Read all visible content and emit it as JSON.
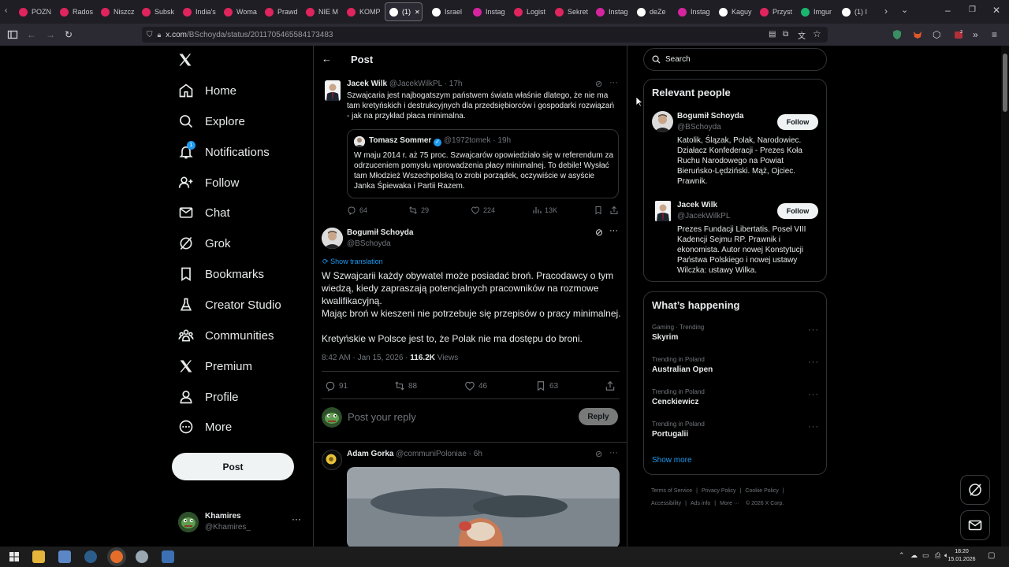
{
  "browser": {
    "tabs": [
      {
        "label": "POZN",
        "fav": "#e0245e"
      },
      {
        "label": "Rados",
        "fav": "#e0245e"
      },
      {
        "label": "Niszcz",
        "fav": "#e0245e"
      },
      {
        "label": "Subsk",
        "fav": "#e0245e"
      },
      {
        "label": "India's",
        "fav": "#e0245e"
      },
      {
        "label": "Woma",
        "fav": "#e0245e"
      },
      {
        "label": "Prawd",
        "fav": "#e0245e"
      },
      {
        "label": "NIE M",
        "fav": "#e0245e"
      },
      {
        "label": "KOMP",
        "fav": "#e0245e"
      },
      {
        "label": "(1)",
        "fav": "#ffffff",
        "active": true
      },
      {
        "label": "Israel",
        "fav": "#ffffff"
      },
      {
        "label": "Instag",
        "fav": "#d6249f"
      },
      {
        "label": "Logist",
        "fav": "#e0245e"
      },
      {
        "label": "Sekret",
        "fav": "#e0245e"
      },
      {
        "label": "Instag",
        "fav": "#d6249f"
      },
      {
        "label": "deZe",
        "fav": "#ffffff"
      },
      {
        "label": "Instag",
        "fav": "#d6249f"
      },
      {
        "label": "Kaguy",
        "fav": "#ffffff"
      },
      {
        "label": "Przyst",
        "fav": "#e0245e"
      },
      {
        "label": "Imgur",
        "fav": "#1bb76e"
      },
      {
        "label": "(1) I",
        "fav": "#ffffff"
      }
    ],
    "url_host": "x.com",
    "url_path": "/BSchoyda/status/2011705465584173483"
  },
  "nav": {
    "items": [
      {
        "label": "Home",
        "icon": "home-icon"
      },
      {
        "label": "Explore",
        "icon": "search-icon"
      },
      {
        "label": "Notifications",
        "icon": "bell-icon",
        "badge": "1"
      },
      {
        "label": "Follow",
        "icon": "add-user-icon"
      },
      {
        "label": "Chat",
        "icon": "mail-icon"
      },
      {
        "label": "Grok",
        "icon": "grok-icon"
      },
      {
        "label": "Bookmarks",
        "icon": "bookmark-icon"
      },
      {
        "label": "Creator Studio",
        "icon": "flask-icon"
      },
      {
        "label": "Communities",
        "icon": "communities-icon"
      },
      {
        "label": "Premium",
        "icon": "x-logo-icon"
      },
      {
        "label": "Profile",
        "icon": "person-icon"
      },
      {
        "label": "More",
        "icon": "more-circle-icon"
      }
    ],
    "post_label": "Post",
    "account": {
      "name": "Khamires",
      "handle": "@Khamires_"
    }
  },
  "header": {
    "title": "Post"
  },
  "parent_tweet": {
    "name": "Jacek Wilk",
    "handle": "@JacekWilkPL",
    "time": "· 17h",
    "text": "Szwajcaria jest najbogatszym państwem świata właśnie dlatego, że nie ma tam kretyńskich i destrukcyjnych dla przedsiębiorców i gospodarki rozwiązań - jak na przykład płaca minimalna.",
    "quote": {
      "name": "Tomasz Sommer",
      "handle": "@1972tomek",
      "time": "· 19h",
      "text": "W maju 2014 r. aż 75 proc. Szwajcarów opowiedziało się w referendum za odrzuceniem pomysłu wprowadzenia płacy minimalnej. To debile! Wysłać tam Młodzież Wszechpolską to zrobi porządek, oczywiście w asyście Janka Śpiewaka i Partii Razem."
    },
    "stats": {
      "replies": "64",
      "reposts": "29",
      "likes": "224",
      "views": "13K"
    }
  },
  "main_tweet": {
    "name": "Bogumił Schoyda",
    "handle": "@BSchoyda",
    "show_translation": "Show translation",
    "text_1": "W Szwajcarii każdy obywatel może posiadać broń. Pracodawcy o tym wiedzą, kiedy zapraszają potencjalnych pracowników na rozmowe kwalifikacyjną.",
    "text_2": "Mając broń w kieszeni nie potrzebuje się przepisów o pracy minimalnej.",
    "text_3": "Kretyńskie w Polsce jest to, że Polak nie ma dostępu do broni.",
    "meta_time": "8:42 AM · Jan 15, 2026 ·",
    "meta_views": "116.2K",
    "meta_views_label": "Views",
    "stats": {
      "replies": "91",
      "reposts": "88",
      "likes": "46",
      "bookmarks": "63"
    }
  },
  "reply": {
    "placeholder": "Post your reply",
    "button": "Reply"
  },
  "next_tweet": {
    "name": "Adam Gorka",
    "handle": "@communiPoloniae",
    "time": "· 6h"
  },
  "search": {
    "placeholder": "Search"
  },
  "relevant": {
    "title": "Relevant people",
    "people": [
      {
        "name": "Bogumił Schoyda",
        "handle": "@BSchoyda",
        "follow": "Follow",
        "bio": "Katolik, Ślązak, Polak, Narodowiec. Działacz Konfederacji - Prezes Koła Ruchu Narodowego na Powiat Bieruńsko-Lędziński. Mąż, Ojciec. Prawnik."
      },
      {
        "name": "Jacek Wilk",
        "handle": "@JacekWilkPL",
        "follow": "Follow",
        "bio": "Prezes Fundacji Libertatis. Poseł VIII Kadencji Sejmu RP. Prawnik i ekonomista. Autor nowej Konstytucji Państwa Polskiego i nowej ustawy Wilczka: ustawy Wilka."
      }
    ]
  },
  "happening": {
    "title": "What’s happening",
    "trends": [
      {
        "sub": "Gaming · Trending",
        "name": "Skyrim"
      },
      {
        "sub": "Trending in Poland",
        "name": "Australian Open"
      },
      {
        "sub": "Trending in Poland",
        "name": "Cenckiewicz"
      },
      {
        "sub": "Trending in Poland",
        "name": "Portugalii"
      }
    ],
    "show_more": "Show more"
  },
  "footer": {
    "links": [
      "Terms of Service",
      "|",
      "Privacy Policy",
      "|",
      "Cookie Policy",
      "|",
      "Accessibility",
      "|",
      "Ads info",
      "|",
      "More ···",
      "© 2026 X Corp."
    ]
  },
  "taskbar": {
    "time": "18:20",
    "date": "15.01.2026"
  },
  "colors": {
    "accent": "#1d9bf0",
    "bg": "#000000",
    "border": "#2f3336",
    "muted": "#71767b"
  }
}
